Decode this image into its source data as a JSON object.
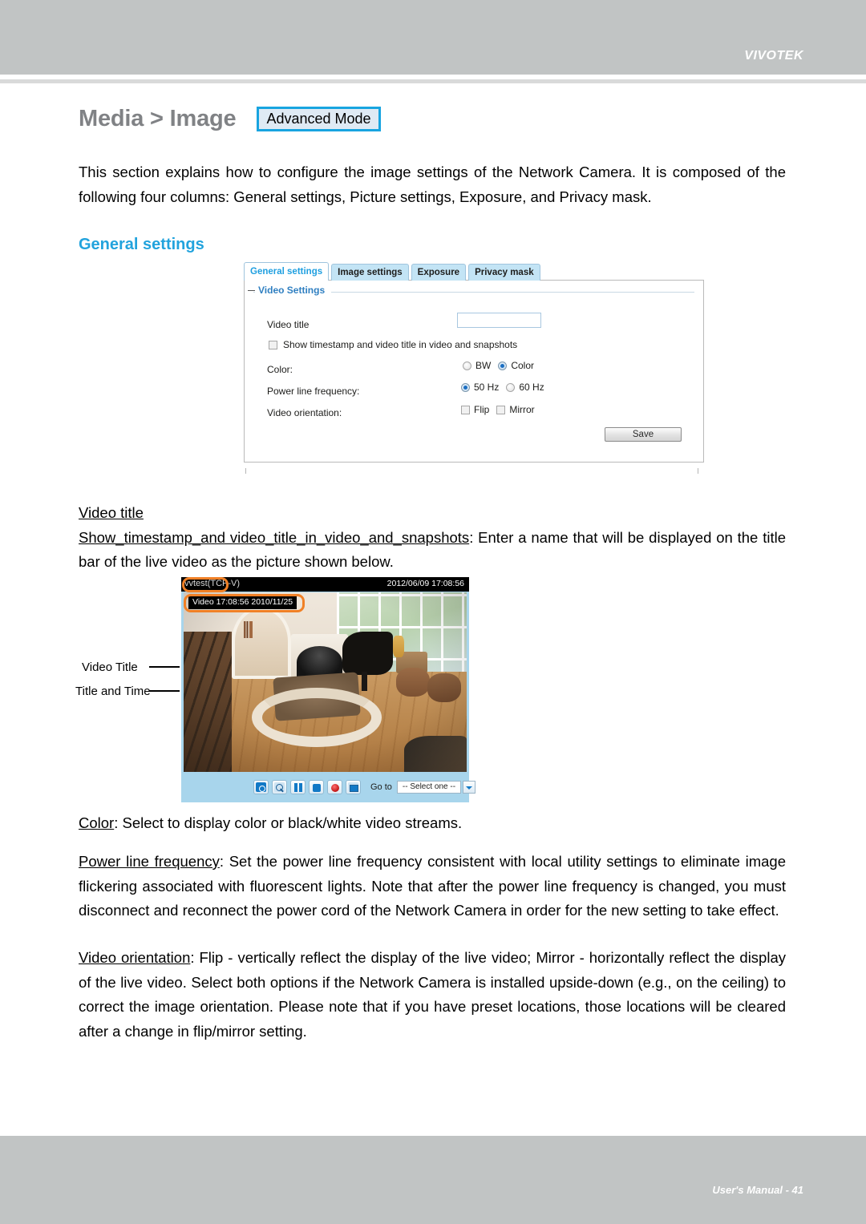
{
  "header": {
    "brand": "VIVOTEK"
  },
  "footer": {
    "text": "User's Manual - 41"
  },
  "page": {
    "title": "Media > Image",
    "mode_badge": "Advanced Mode",
    "intro": "This section explains how to configure the image settings of the Network Camera. It is composed of the following four columns: General settings, Picture settings, Exposure, and Privacy mask.",
    "section_heading": "General settings"
  },
  "settings_panel": {
    "tabs": [
      {
        "label": "General settings",
        "active": true
      },
      {
        "label": "Image settings",
        "active": false
      },
      {
        "label": "Exposure",
        "active": false
      },
      {
        "label": "Privacy mask",
        "active": false
      }
    ],
    "legend": "Video Settings",
    "video_title_label": "Video title",
    "video_title_value": "",
    "show_timestamp_label": "Show timestamp and video title in video and snapshots",
    "show_timestamp_checked": false,
    "color_label": "Color:",
    "color_options": [
      {
        "label": "BW",
        "selected": false
      },
      {
        "label": "Color",
        "selected": true
      }
    ],
    "power_line_label": "Power line frequency:",
    "power_line_options": [
      {
        "label": "50 Hz",
        "selected": true
      },
      {
        "label": "60 Hz",
        "selected": false
      }
    ],
    "orientation_label": "Video orientation:",
    "orientation_options": [
      {
        "label": "Flip",
        "checked": false
      },
      {
        "label": "Mirror",
        "checked": false
      }
    ],
    "save_label": "Save"
  },
  "doc_body": {
    "video_title_heading": "Video title",
    "show_timestamp_term": "Show_timestamp_and video_title_in_video_and_snapshots",
    "show_timestamp_desc": ": Enter a name that will be displayed on the title bar of the live video as the picture shown below.",
    "color_term": "Color",
    "color_desc": ": Select to display color or black/white video streams.",
    "power_line_term": "Power line frequency",
    "power_line_desc": ": Set the power line frequency consistent with local utility settings to eliminate image flickering associated with fluorescent lights. Note that after the power line frequency is changed, you must disconnect and reconnect the power cord of the Network Camera in order for the new setting to take effect.",
    "orientation_term": "Video orientation",
    "orientation_desc": ": Flip - vertically reflect the display of the live video; Mirror - horizontally reflect the display of the live video. Select both options if the Network Camera is installed upside-down (e.g., on the ceiling) to correct the image orientation. Please note that if you have preset locations, those locations will be cleared after a change in flip/mirror setting."
  },
  "video_figure": {
    "callout_video_title": "Video Title",
    "callout_title_and_time": "Title and Time",
    "titlebar_title": "vvtest(TCP-V)",
    "titlebar_timestamp": "2012/06/09  17:08:56",
    "osd_overlay": "Video 17:08:56  2010/11/25",
    "controls": [
      {
        "name": "snapshot"
      },
      {
        "name": "digital-zoom"
      },
      {
        "name": "pause"
      },
      {
        "name": "stop"
      },
      {
        "name": "record"
      },
      {
        "name": "fullscreen"
      }
    ],
    "goto_label": "Go to",
    "goto_value": "-- Select one --"
  },
  "colors": {
    "brand_gray": "#c1c4c4",
    "accent_blue": "#22a3dd",
    "badge_border": "#18a4e0",
    "highlight_orange": "#f08026",
    "title_gray": "#808285"
  }
}
